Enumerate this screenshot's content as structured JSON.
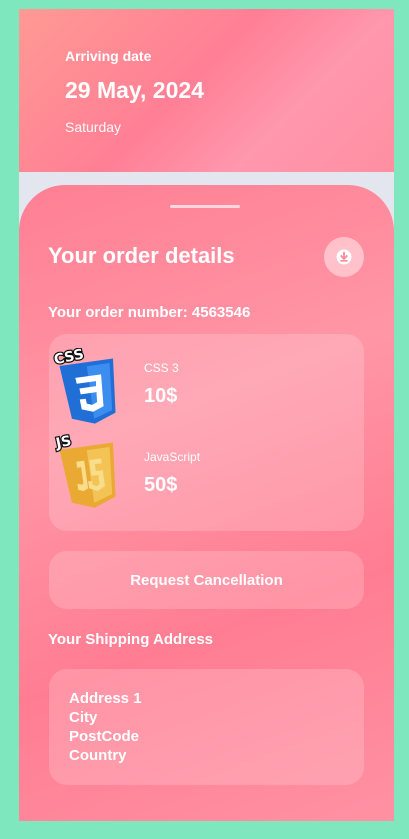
{
  "header": {
    "label": "Arriving date",
    "date": "29 May, 2024",
    "day": "Saturday"
  },
  "order": {
    "title": "Your order details",
    "download_icon": "download-circle-icon",
    "number_text": "Your order number: 4563546",
    "items": [
      {
        "name": "CSS 3",
        "price": "10$",
        "logo_icon": "css3-logo-icon"
      },
      {
        "name": "JavaScript",
        "price": "50$",
        "logo_icon": "javascript-logo-icon"
      }
    ],
    "cancel_label": "Request Cancellation"
  },
  "shipping": {
    "title": "Your Shipping Address",
    "lines": [
      "Address 1",
      "City",
      "PostCode",
      "Country"
    ]
  },
  "colors": {
    "background": "#7ee7bd",
    "accent": "#ff7f93",
    "css_blue": "#1f6fd6",
    "js_yellow": "#f0b43b"
  }
}
